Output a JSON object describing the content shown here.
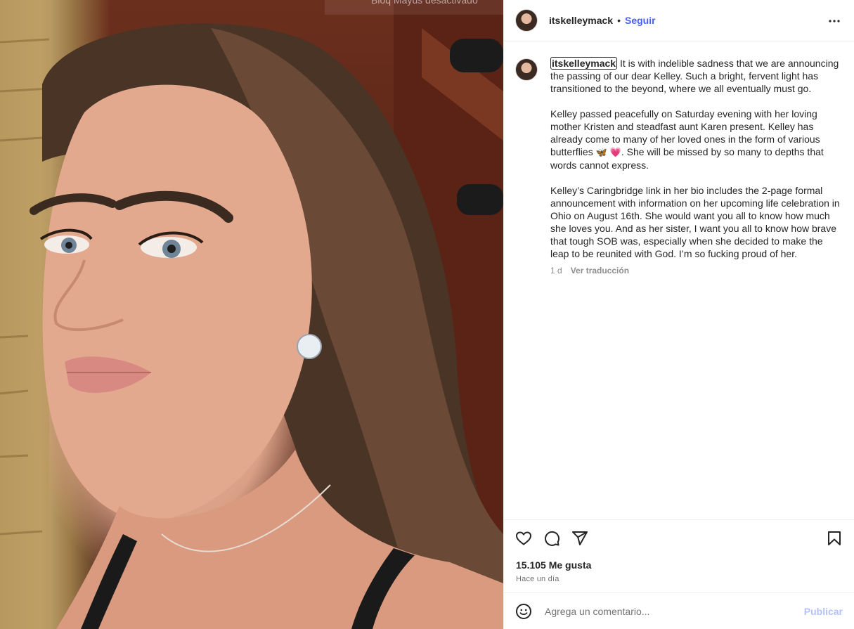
{
  "photo": {
    "caps_lock_tooltip": "Bloq Mayús desactivado"
  },
  "header": {
    "username": "itskelleymack",
    "separator": "•",
    "follow_label": "Seguir",
    "more_icon": "more-horizontal-icon"
  },
  "caption": {
    "username": "itskelleymack",
    "paragraph_1": " It is with indelible sadness that we are announcing the passing of our dear Kelley. Such a bright, fervent light has transitioned to the beyond, where we all eventually must go.",
    "paragraph_2_before_emoji": "Kelley passed peacefully on Saturday evening with her loving mother Kristen and steadfast aunt Karen present. Kelley has already come to many of her loved ones in the form of various butterflies ",
    "emoji_butterfly": "🦋",
    "emoji_heart": "💗",
    "paragraph_2_after_emoji": ". She will be missed by so many to depths that words cannot express.",
    "paragraph_3": "Kelley’s Caringbridge link in her bio includes the 2-page formal announcement with information on her upcoming life celebration in Ohio on August 16th. She would want you all to know how much she loves you. And as her sister, I want you all to know how brave that tough SOB was, especially when she decided to make the leap to be reunited with God. I’m so fucking proud of her.",
    "age": "1 d",
    "translate_label": "Ver traducción"
  },
  "actions": {
    "like_icon": "heart-icon",
    "comment_icon": "comment-icon",
    "share_icon": "share-icon",
    "save_icon": "bookmark-icon"
  },
  "likes_text": "15.105 Me gusta",
  "time_text": "Hace un día",
  "comment": {
    "emoji_icon": "smiley-icon",
    "placeholder": "Agrega un comentario...",
    "publish_label": "Publicar"
  },
  "colors": {
    "accent": "#4a5df9",
    "publish_disabled": "#b3c2fb",
    "text_primary": "#262626",
    "text_secondary": "#737373",
    "border": "#efefef"
  }
}
